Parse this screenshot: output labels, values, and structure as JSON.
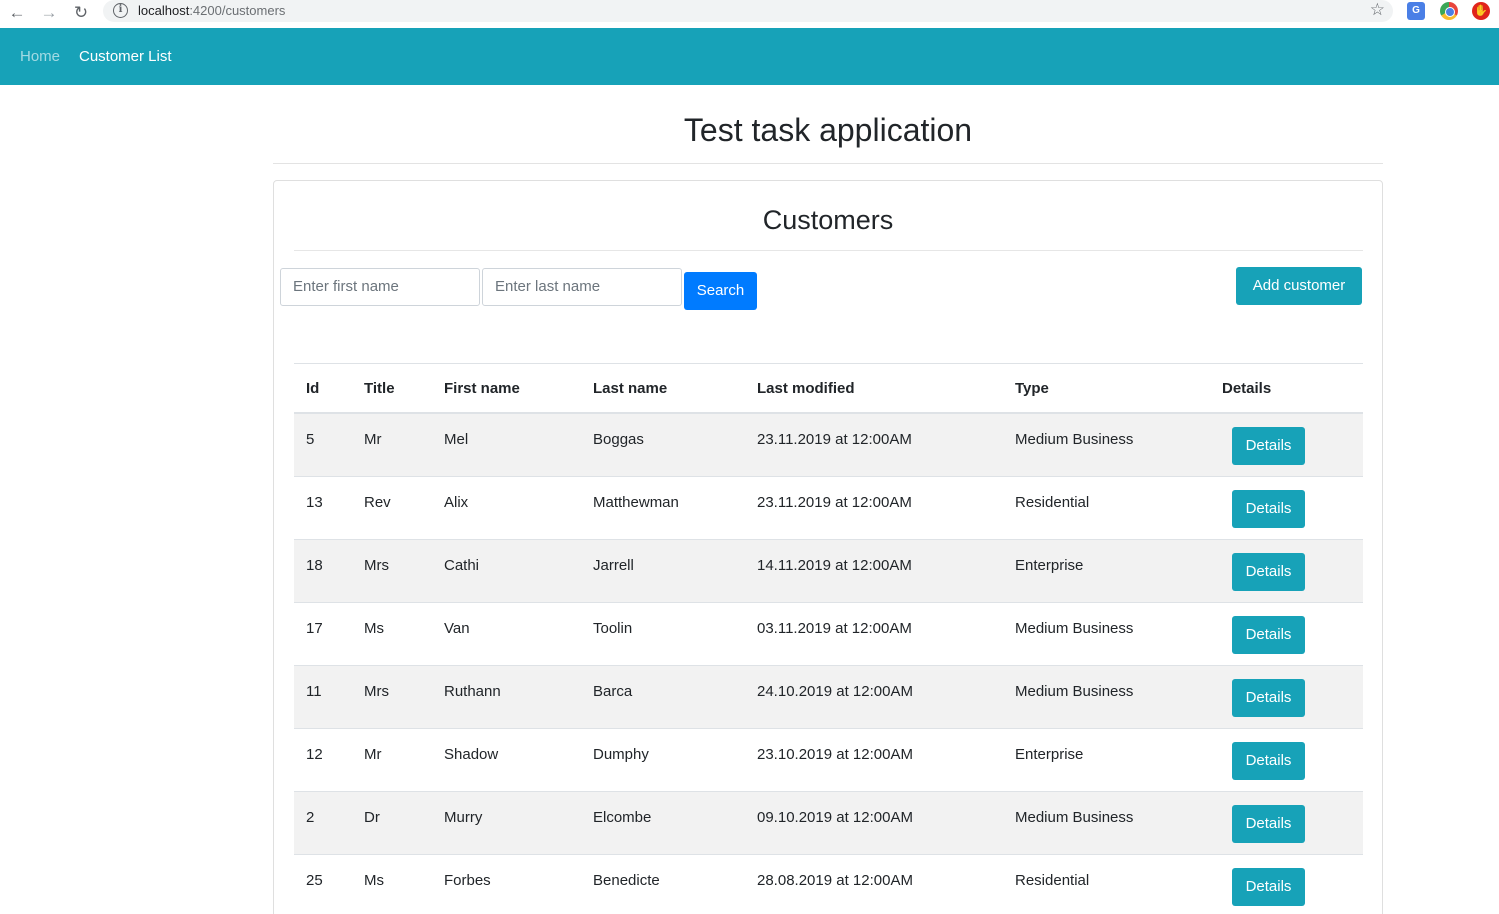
{
  "browser": {
    "url_host": "localhost",
    "url_path": ":4200/customers"
  },
  "navbar": {
    "home": "Home",
    "customer_list": "Customer List"
  },
  "app_title": "Test task application",
  "card": {
    "title": "Customers",
    "first_name_placeholder": "Enter first name",
    "last_name_placeholder": "Enter last name",
    "search_label": "Search",
    "add_customer_label": "Add customer"
  },
  "table": {
    "headers": [
      "Id",
      "Title",
      "First name",
      "Last name",
      "Last modified",
      "Type",
      "Details"
    ],
    "details_label": "Details",
    "rows": [
      {
        "id": "5",
        "title": "Mr",
        "first": "Mel",
        "last": "Boggas",
        "modified": "23.11.2019 at 12:00AM",
        "type": "Medium Business"
      },
      {
        "id": "13",
        "title": "Rev",
        "first": "Alix",
        "last": "Matthewman",
        "modified": "23.11.2019 at 12:00AM",
        "type": "Residential"
      },
      {
        "id": "18",
        "title": "Mrs",
        "first": "Cathi",
        "last": "Jarrell",
        "modified": "14.11.2019 at 12:00AM",
        "type": "Enterprise"
      },
      {
        "id": "17",
        "title": "Ms",
        "first": "Van",
        "last": "Toolin",
        "modified": "03.11.2019 at 12:00AM",
        "type": "Medium Business"
      },
      {
        "id": "11",
        "title": "Mrs",
        "first": "Ruthann",
        "last": "Barca",
        "modified": "24.10.2019 at 12:00AM",
        "type": "Medium Business"
      },
      {
        "id": "12",
        "title": "Mr",
        "first": "Shadow",
        "last": "Dumphy",
        "modified": "23.10.2019 at 12:00AM",
        "type": "Enterprise"
      },
      {
        "id": "2",
        "title": "Dr",
        "first": "Murry",
        "last": "Elcombe",
        "modified": "09.10.2019 at 12:00AM",
        "type": "Medium Business"
      },
      {
        "id": "25",
        "title": "Ms",
        "first": "Forbes",
        "last": "Benedicte",
        "modified": "28.08.2019 at 12:00AM",
        "type": "Residential"
      }
    ]
  },
  "colors": {
    "navbar": "#17a2b8",
    "primary": "#007bff",
    "info": "#17a2b8"
  }
}
